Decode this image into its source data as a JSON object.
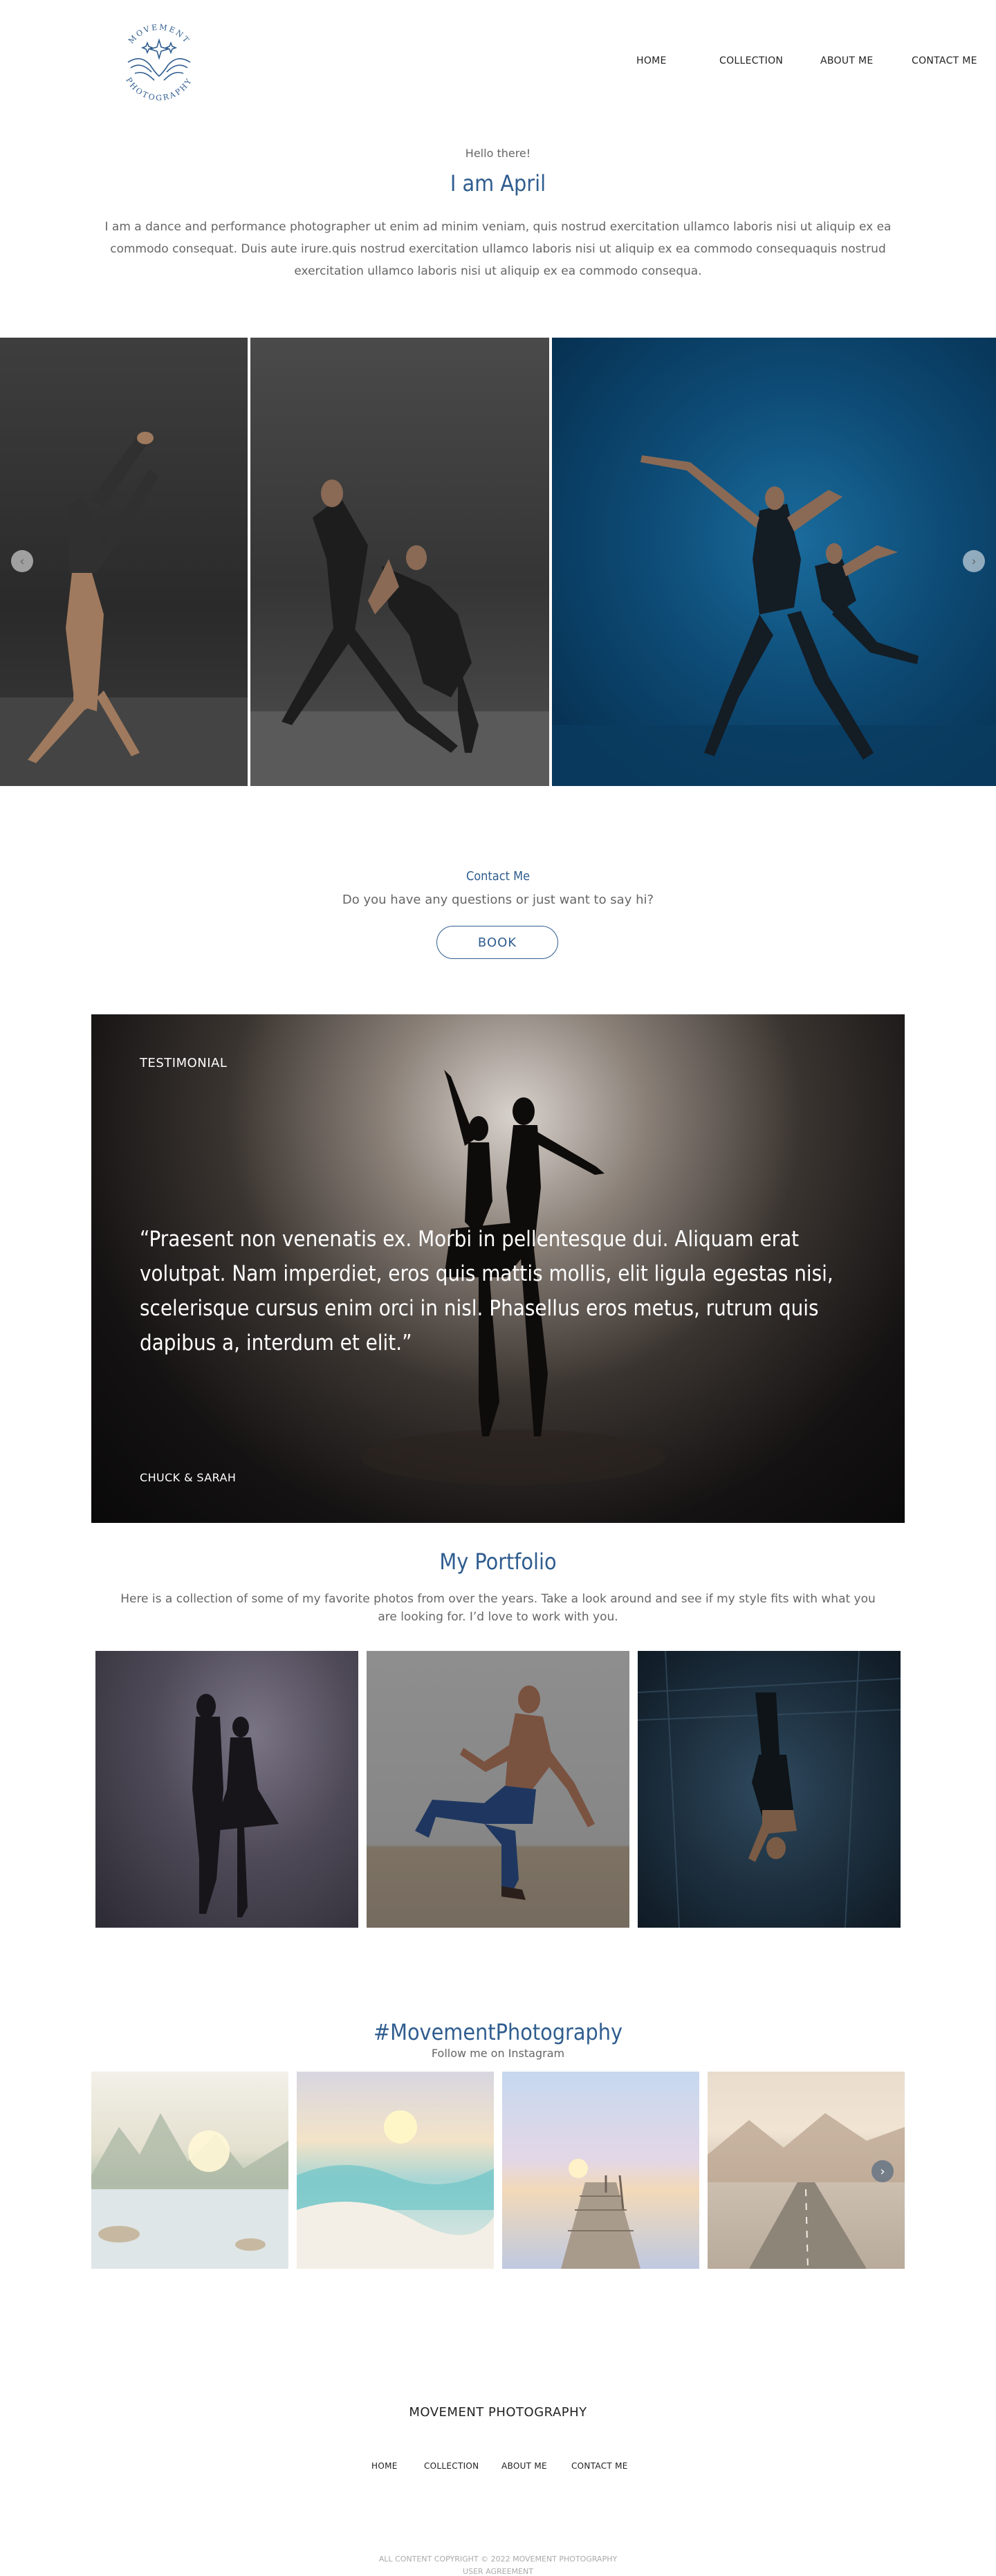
{
  "brand": {
    "logo_top": "MOVEMENT",
    "logo_bottom": "PHOTOGRAPHY",
    "accent_color": "#2f5d8f"
  },
  "nav": {
    "items": [
      "HOME",
      "COLLECTION",
      "ABOUT ME",
      "CONTACT ME"
    ]
  },
  "intro": {
    "greeting": "Hello there!",
    "title": "I am April",
    "body": "I am a dance and performance photographer ut enim ad minim veniam, quis nostrud exercitation ullamco laboris nisi ut aliquip ex ea commodo consequat. Duis aute irure.quis nostrud exercitation ullamco laboris nisi ut aliquip ex ea commodo consequaquis nostrud exercitation ullamco laboris nisi ut aliquip ex ea commodo consequa."
  },
  "carousel": {
    "prev_icon": "chevron-left-icon",
    "next_icon": "chevron-right-icon"
  },
  "contact": {
    "title": "Contact Me",
    "subtitle": "Do you have any questions or just want to say hi?",
    "button": "BOOK"
  },
  "testimonial": {
    "label": "TESTIMONIAL",
    "quote": "“Praesent non venenatis ex. Morbi in pellentesque dui. Aliquam erat volutpat. Nam imperdiet, eros quis mattis mollis, elit ligula egestas nisi, scelerisque cursus enim orci in nisl. Phasellus eros metus, rutrum quis dapibus a, interdum et elit.”",
    "author": "CHUCK & SARAH"
  },
  "portfolio": {
    "title": "My Portfolio",
    "body": "Here is a collection of some of my favorite photos from over the years. Take a look around and see if my style fits with what you are looking for. I’d love to work with you."
  },
  "instagram": {
    "title": "#MovementPhotography",
    "subtitle": "Follow me on Instagram",
    "next_icon": "chevron-right-icon"
  },
  "footer": {
    "brand": "MOVEMENT PHOTOGRAPHY",
    "nav": [
      "HOME",
      "COLLECTION",
      "ABOUT ME",
      "CONTACT ME"
    ],
    "copyright": "ALL CONTENT COPYRIGHT © 2022 MOVEMENT PHOTOGRAPHY",
    "agreement": "USER AGREEMENT"
  }
}
